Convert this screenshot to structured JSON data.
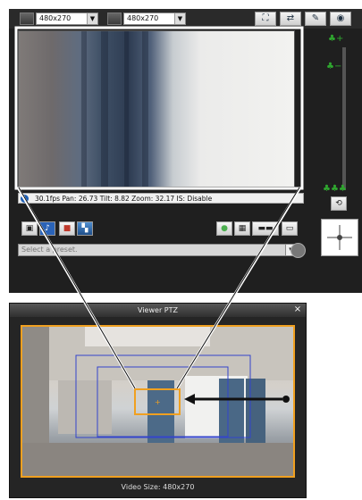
{
  "top_toolbar": {
    "size_select_1": "480x270",
    "size_select_2": "480x270",
    "tools": [
      "fit-screen",
      "swap",
      "settings",
      "camera"
    ]
  },
  "status_bar": {
    "text": "30.1fps Pan: 26.73 Tilt: 8.82 Zoom: 32.17 IS: Disable"
  },
  "preset": {
    "placeholder": "Select a preset."
  },
  "ptz_window": {
    "title": "Viewer PTZ",
    "close_label": "×",
    "video_size": "Video Size: 480x270"
  },
  "icons": {
    "zoom_in": "tree-plus-icon",
    "zoom_out": "tree-minus-icon",
    "wide": "trees-icon",
    "snapshot": "camera-icon",
    "record": "record-icon",
    "green": "green-circle-icon",
    "pan_pad": "crosshair-icon"
  },
  "colors": {
    "frame_orange": "#f0a020",
    "callout_white": "#ffffff",
    "blue_box": "#3344cc"
  }
}
